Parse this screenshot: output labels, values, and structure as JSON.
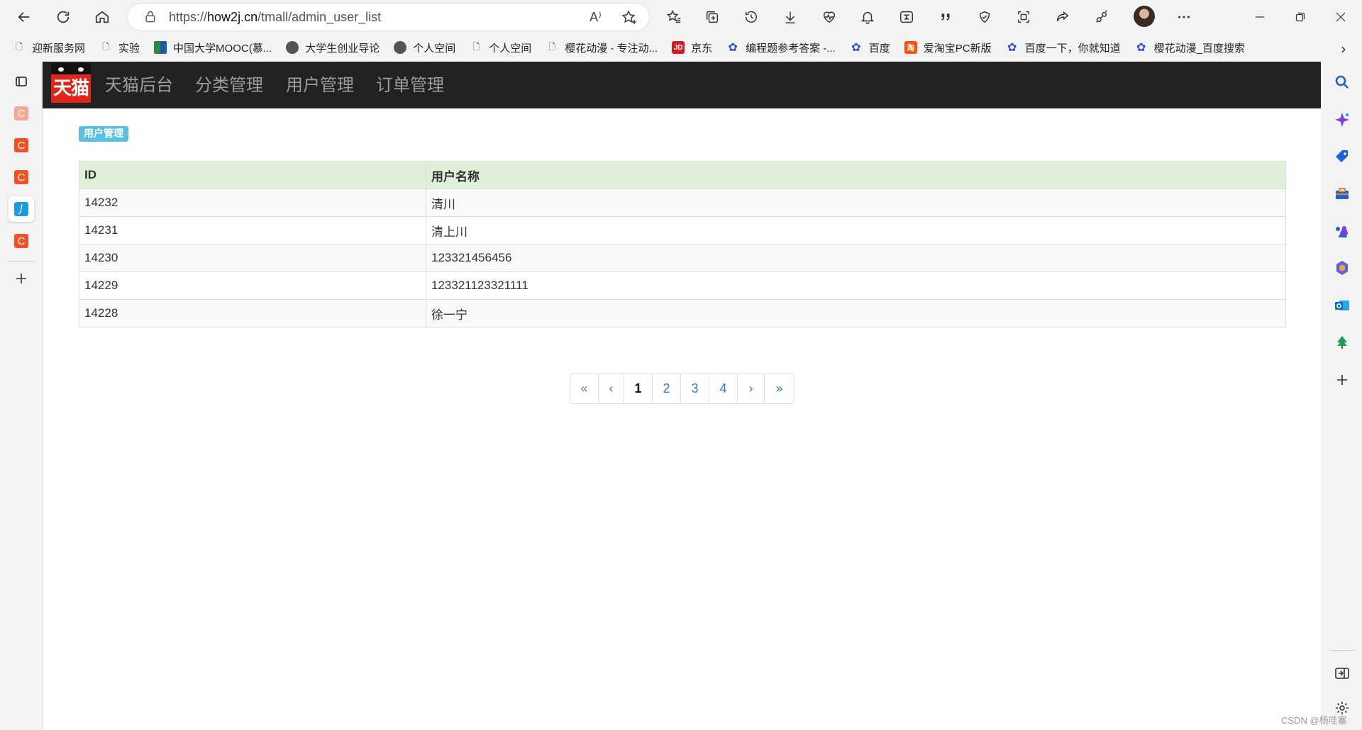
{
  "browser": {
    "url_prefix": "https://",
    "url_domain": "how2j.cn",
    "url_path": "/tmall/admin_user_list",
    "read_aloud_glyph": "A⁾"
  },
  "bookmarks": [
    {
      "label": "迎新服务网",
      "icon": "doc-icon"
    },
    {
      "label": "实验",
      "icon": "doc-icon"
    },
    {
      "label": "中国大学MOOC(慕...",
      "icon": "mooc-icon"
    },
    {
      "label": "大学生创业导论",
      "icon": "globe-icon"
    },
    {
      "label": "个人空间",
      "icon": "globe-icon"
    },
    {
      "label": "个人空间",
      "icon": "doc-icon"
    },
    {
      "label": "樱花动漫 - 专注动...",
      "icon": "doc-icon"
    },
    {
      "label": "京东",
      "icon": "jd-icon"
    },
    {
      "label": "编程题参考答案 -...",
      "icon": "baidu-paw-icon"
    },
    {
      "label": "百度",
      "icon": "baidu-paw-icon"
    },
    {
      "label": "爱淘宝PC新版",
      "icon": "taobao-icon"
    },
    {
      "label": "百度一下，你就知道",
      "icon": "baidu-paw-icon"
    },
    {
      "label": "樱花动漫_百度搜索",
      "icon": "baidu-paw-icon"
    }
  ],
  "navbar": {
    "logo_text": "天猫",
    "brand": "天猫后台",
    "links": [
      "分类管理",
      "用户管理",
      "订单管理"
    ]
  },
  "page": {
    "badge": "用户管理",
    "table": {
      "headers": [
        "ID",
        "用户名称"
      ],
      "rows": [
        [
          "14232",
          "清川"
        ],
        [
          "14231",
          "清上川"
        ],
        [
          "14230",
          "123321456456"
        ],
        [
          "14229",
          "123321123321111"
        ],
        [
          "14228",
          "徐一宁"
        ]
      ]
    },
    "pagination": {
      "first": "«",
      "prev": "‹",
      "pages": [
        "1",
        "2",
        "3",
        "4"
      ],
      "current": "1",
      "next": "›",
      "last": "»"
    }
  },
  "watermark": "CSDN @杨哇塞",
  "colors": {
    "navbar_bg": "#222222",
    "badge_bg": "#5bc0de",
    "table_header_bg": "#dff0d8",
    "link": "#337ab7",
    "logo_red": "#e1251b"
  }
}
